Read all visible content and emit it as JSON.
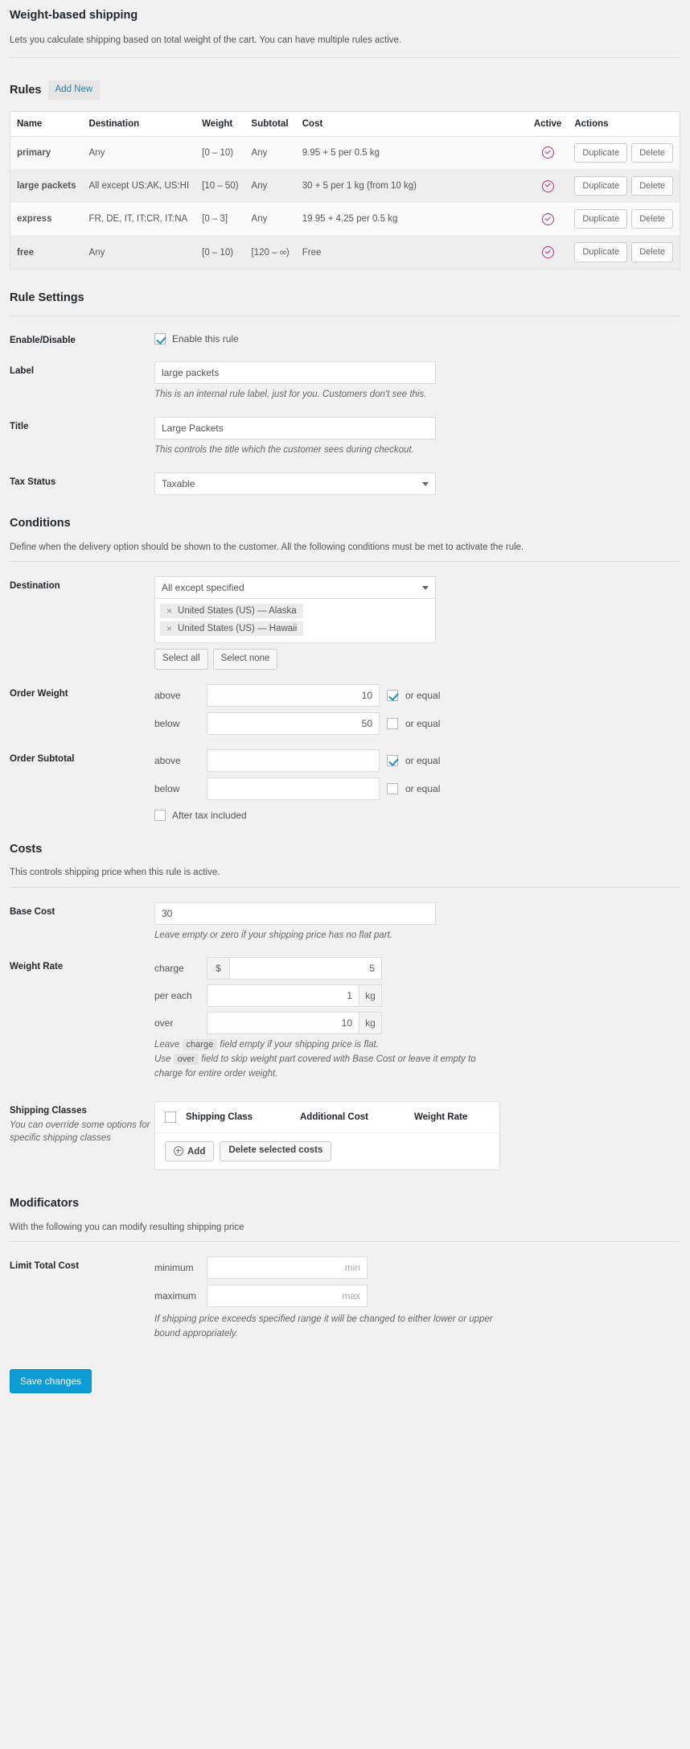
{
  "header": {
    "title": "Weight-based shipping",
    "description": "Lets you calculate shipping based on total weight of the cart. You can have multiple rules active."
  },
  "rules": {
    "heading": "Rules",
    "add_new_label": "Add New",
    "columns": {
      "name": "Name",
      "destination": "Destination",
      "weight": "Weight",
      "subtotal": "Subtotal",
      "cost": "Cost",
      "active": "Active",
      "actions": "Actions"
    },
    "duplicate_label": "Duplicate",
    "delete_label": "Delete",
    "rows": [
      {
        "name": "primary",
        "destination": "Any",
        "weight": "[0 – 10)",
        "subtotal": "Any",
        "cost": "9.95 + 5 per 0.5 kg",
        "active": true
      },
      {
        "name": "large packets",
        "destination": "All except US:AK, US:HI",
        "weight": "[10 – 50)",
        "subtotal": "Any",
        "cost": "30 + 5 per 1 kg (from 10 kg)",
        "active": true
      },
      {
        "name": "express",
        "destination": "FR, DE, IT, IT:CR, IT:NA",
        "weight": "[0 – 3]",
        "subtotal": "Any",
        "cost": "19.95 + 4.25 per 0.5 kg",
        "active": true
      },
      {
        "name": "free",
        "destination": "Any",
        "weight": "[0 – 10)",
        "subtotal": "[120 – ∞)",
        "cost": "Free",
        "active": true
      }
    ]
  },
  "rule_settings": {
    "heading": "Rule Settings",
    "enable": {
      "label": "Enable/Disable",
      "checkbox_text": "Enable this rule",
      "checked": true
    },
    "label_field": {
      "label": "Label",
      "value": "large packets",
      "hint": "This is an internal rule label, just for you. Customers don't see this."
    },
    "title_field": {
      "label": "Title",
      "value": "Large Packets",
      "hint": "This controls the title which the customer sees during checkout."
    },
    "tax_status": {
      "label": "Tax Status",
      "value": "Taxable"
    }
  },
  "conditions": {
    "heading": "Conditions",
    "description": "Define when the delivery option should be shown to the customer. All the following conditions must be met to activate the rule.",
    "destination": {
      "label": "Destination",
      "mode": "All except specified",
      "tokens": [
        "United States (US) — Alaska",
        "United States (US) — Hawaii"
      ],
      "select_all_label": "Select all",
      "select_none_label": "Select none"
    },
    "order_weight": {
      "label": "Order Weight",
      "above_label": "above",
      "above_value": "10",
      "above_or_equal": true,
      "below_label": "below",
      "below_value": "50",
      "below_or_equal": false,
      "or_equal_label": "or equal"
    },
    "order_subtotal": {
      "label": "Order Subtotal",
      "above_label": "above",
      "above_value": "",
      "above_or_equal": true,
      "below_label": "below",
      "below_value": "",
      "below_or_equal": false,
      "or_equal_label": "or equal",
      "after_tax_label": "After tax included",
      "after_tax_checked": false
    }
  },
  "costs": {
    "heading": "Costs",
    "description": "This controls shipping price when this rule is active.",
    "base_cost": {
      "label": "Base Cost",
      "value": "30",
      "hint": "Leave empty or zero if your shipping price has no flat part."
    },
    "weight_rate": {
      "label": "Weight Rate",
      "charge_label": "charge",
      "charge_addon": "$",
      "charge_value": "5",
      "per_each_label": "per each",
      "per_each_value": "1",
      "per_each_unit": "kg",
      "over_label": "over",
      "over_value": "10",
      "over_unit": "kg",
      "hint_1_pre": "Leave",
      "hint_1_kw": "charge",
      "hint_1_post": "field empty if your shipping price is flat.",
      "hint_2_pre": "Use",
      "hint_2_kw": "over",
      "hint_2_post": "field to skip weight part covered with Base Cost or leave it empty to charge for entire order weight."
    },
    "shipping_classes": {
      "label": "Shipping Classes",
      "sub": "You can override some options for specific shipping classes",
      "col_class": "Shipping Class",
      "col_additional_cost": "Additional Cost",
      "col_weight_rate": "Weight Rate",
      "add_label": "Add",
      "delete_label": "Delete selected costs",
      "select_all_checked": false
    }
  },
  "modificators": {
    "heading": "Modificators",
    "description": "With the following you can modify resulting shipping price",
    "limit_total_cost": {
      "label": "Limit Total Cost",
      "minimum_label": "minimum",
      "minimum_value": "",
      "minimum_placeholder": "min",
      "maximum_label": "maximum",
      "maximum_value": "",
      "maximum_placeholder": "max",
      "hint": "If shipping price exceeds specified range it will be changed to either lower or upper bound appropriately."
    }
  },
  "footer": {
    "save_label": "Save changes"
  }
}
